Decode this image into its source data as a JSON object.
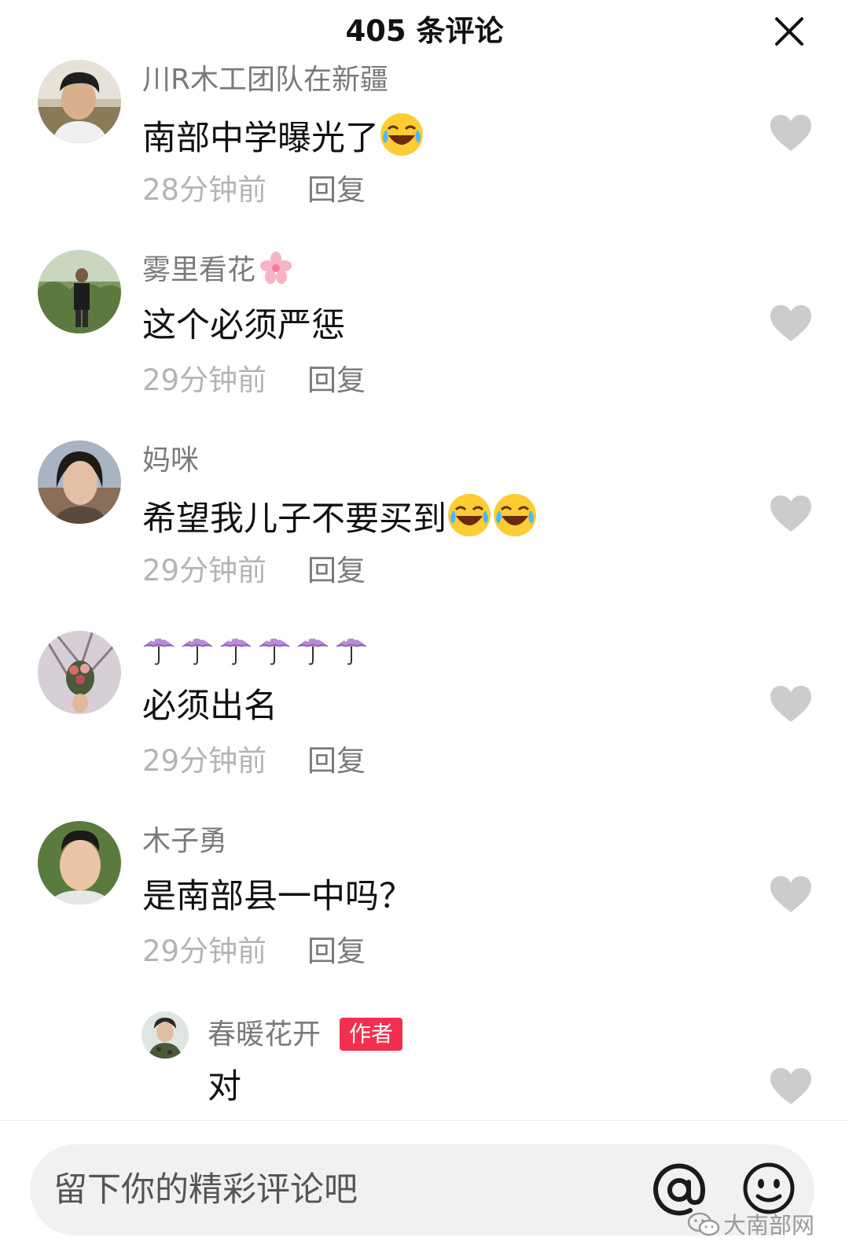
{
  "header": {
    "title": "405 条评论",
    "close_icon": "close-icon"
  },
  "comments": [
    {
      "username": "川R木工团队在新疆",
      "text": "南部中学曝光了",
      "emojis": [
        "laugh-cry-emoji"
      ],
      "time": "28分钟前",
      "reply_label": "回复"
    },
    {
      "username": "雾里看花",
      "username_icon": "sakura-icon",
      "text": "这个必须严惩",
      "time": "29分钟前",
      "reply_label": "回复"
    },
    {
      "username": "妈咪",
      "text": "希望我儿子不要买到",
      "emojis": [
        "laugh-cry-emoji",
        "laugh-cry-emoji"
      ],
      "time": "29分钟前",
      "reply_label": "回复"
    },
    {
      "username_icons": [
        "umbrella-icon",
        "umbrella-icon",
        "umbrella-icon",
        "umbrella-icon",
        "umbrella-icon",
        "umbrella-icon"
      ],
      "text": "必须出名",
      "time": "29分钟前",
      "reply_label": "回复"
    },
    {
      "username": "木子勇",
      "text": "是南部县一中吗？",
      "time": "29分钟前",
      "reply_label": "回复"
    }
  ],
  "sub_reply": {
    "username": "春暖花开",
    "badge": "作者",
    "text": "对"
  },
  "input": {
    "placeholder": "留下你的精彩评论吧"
  },
  "watermark": {
    "text": "大南部网"
  },
  "colors": {
    "badge": "#f2304e",
    "like": "#cccccc",
    "time": "#b4b4b4",
    "username": "#7a7a7a"
  }
}
